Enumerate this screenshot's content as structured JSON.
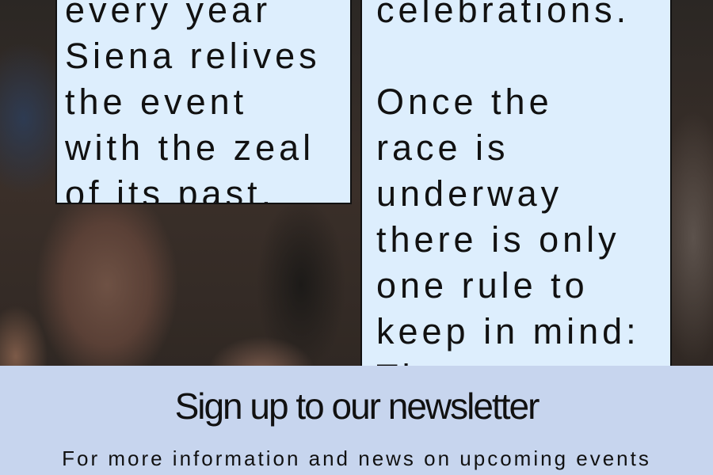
{
  "left_panel": {
    "paragraphs": [
      "every year\nSiena relives\nthe event\nwith the zeal\nof its past."
    ]
  },
  "right_panel": {
    "paragraphs": [
      "celebrations.",
      "Once the\nrace is\nunderway\nthere is only\none rule to\nkeep in mind:\nThere are no"
    ]
  },
  "newsletter": {
    "title": "Sign up to our newsletter",
    "description": "For more information and news on upcoming events"
  },
  "colors": {
    "panel_background": "#ddeefd",
    "newsletter_background": "#c7d5ee",
    "text": "#111111"
  }
}
